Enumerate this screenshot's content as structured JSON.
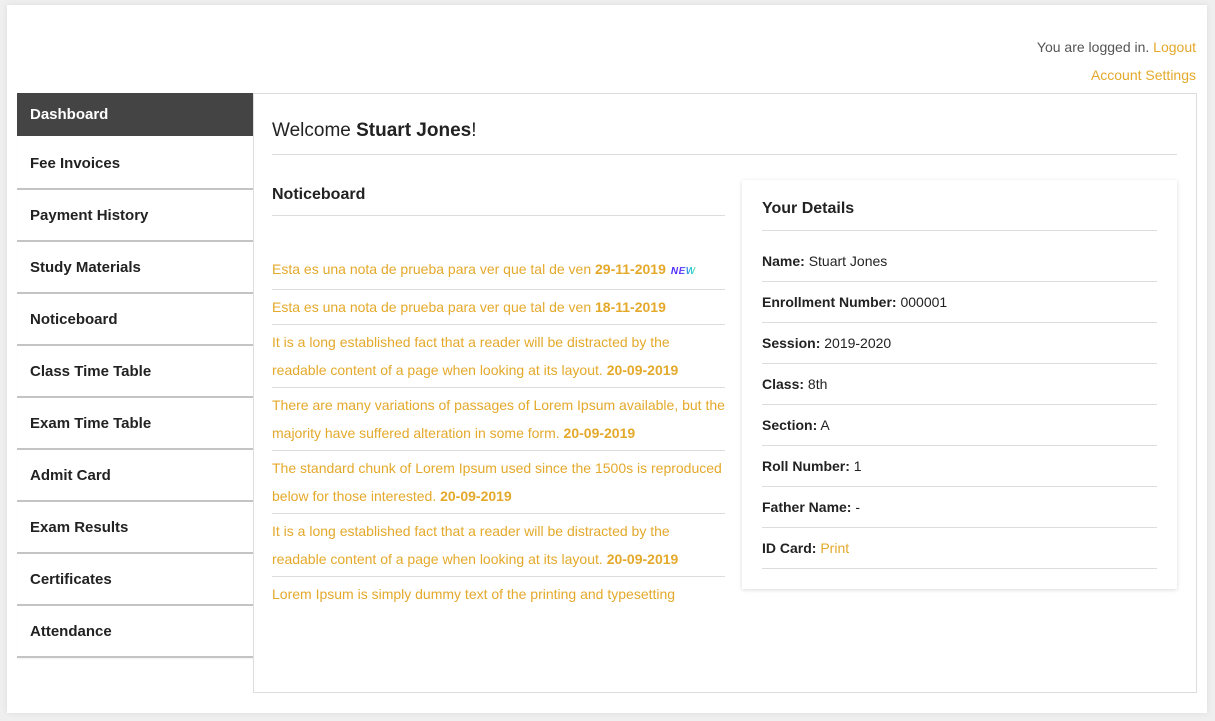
{
  "topbar": {
    "logged_in_text": "You are logged in.",
    "logout_label": "Logout",
    "account_settings_label": "Account Settings"
  },
  "sidebar": {
    "items": [
      {
        "label": "Dashboard",
        "active": true
      },
      {
        "label": "Fee Invoices"
      },
      {
        "label": "Payment History"
      },
      {
        "label": "Study Materials"
      },
      {
        "label": "Noticeboard"
      },
      {
        "label": "Class Time Table"
      },
      {
        "label": "Exam Time Table"
      },
      {
        "label": "Admit Card"
      },
      {
        "label": "Exam Results"
      },
      {
        "label": "Certificates"
      },
      {
        "label": "Attendance"
      }
    ]
  },
  "welcome": {
    "prefix": "Welcome ",
    "name": "Stuart Jones",
    "suffix": "!"
  },
  "noticeboard": {
    "title": "Noticeboard",
    "new_badge": "NEW",
    "notices": [
      {
        "text": "Esta es una nota de prueba para ver que tal de ven ",
        "date": "29-11-2019",
        "is_new": true
      },
      {
        "text": "Esta es una nota de prueba para ver que tal de ven ",
        "date": "18-11-2019"
      },
      {
        "text": "It is a long established fact that a reader will be distracted by the readable content of a page when looking at its layout. ",
        "date": "20-09-2019"
      },
      {
        "text": "There are many variations of passages of Lorem Ipsum available, but the majority have suffered alteration in some form. ",
        "date": "20-09-2019"
      },
      {
        "text": "The standard chunk of Lorem Ipsum used since the 1500s is reproduced below for those interested. ",
        "date": "20-09-2019"
      },
      {
        "text": "It is a long established fact that a reader will be distracted by the readable content of a page when looking at its layout. ",
        "date": "20-09-2019"
      },
      {
        "text": "Lorem Ipsum is simply dummy text of the printing and typesetting",
        "date": ""
      }
    ]
  },
  "details": {
    "title": "Your Details",
    "rows": [
      {
        "label": "Name:",
        "value": "Stuart Jones"
      },
      {
        "label": "Enrollment Number:",
        "value": "000001"
      },
      {
        "label": "Session:",
        "value": "2019-2020"
      },
      {
        "label": "Class:",
        "value": "8th"
      },
      {
        "label": "Section:",
        "value": "A"
      },
      {
        "label": "Roll Number:",
        "value": "1"
      },
      {
        "label": "Father Name:",
        "value": "-"
      },
      {
        "label": "ID Card:",
        "link": "Print"
      }
    ]
  },
  "colors": {
    "accent": "#e4a92b",
    "active_nav_bg": "#444444"
  }
}
